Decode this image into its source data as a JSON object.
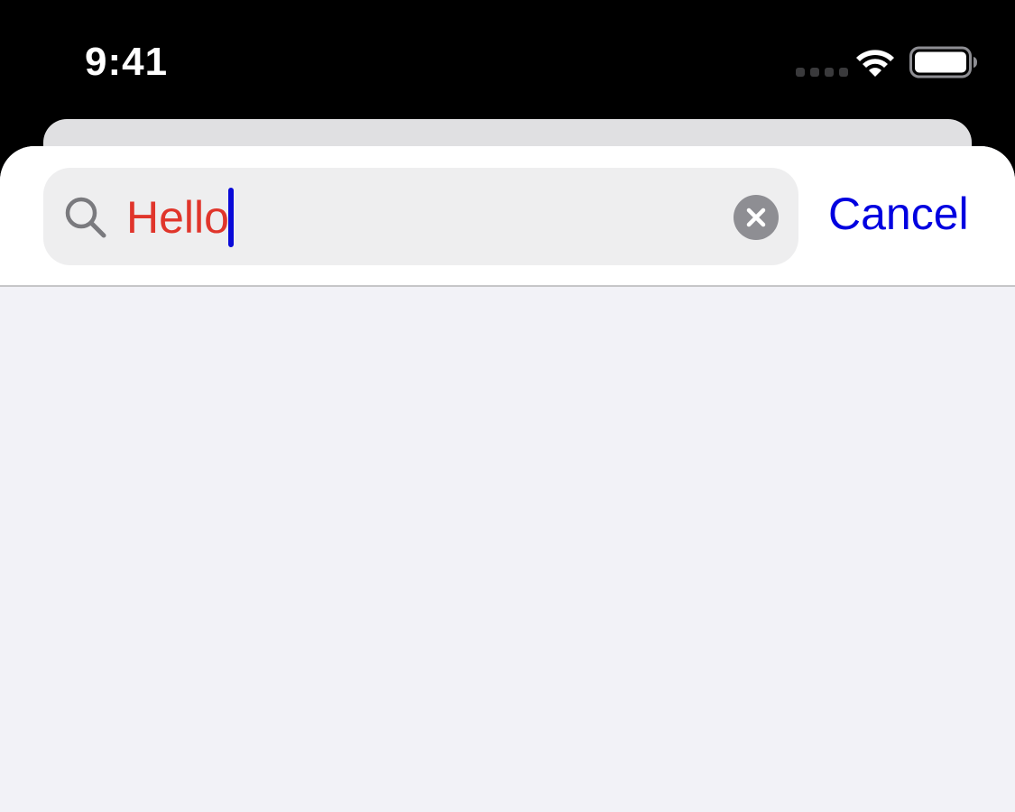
{
  "status_bar": {
    "time": "9:41",
    "signal_icon": "cellular-signal-icon",
    "wifi_icon": "wifi-icon",
    "battery_icon": "battery-icon"
  },
  "search": {
    "value": "Hello",
    "search_icon": "search-icon",
    "clear_icon": "clear-circle-icon",
    "cancel_label": "Cancel"
  },
  "colors": {
    "status_bar_bg": "#000000",
    "search_text": "#e0352b",
    "caret": "#0a0ad8",
    "cancel_tint": "#0000e0",
    "field_bg": "#eeeeef",
    "results_bg": "#f2f2f7"
  }
}
